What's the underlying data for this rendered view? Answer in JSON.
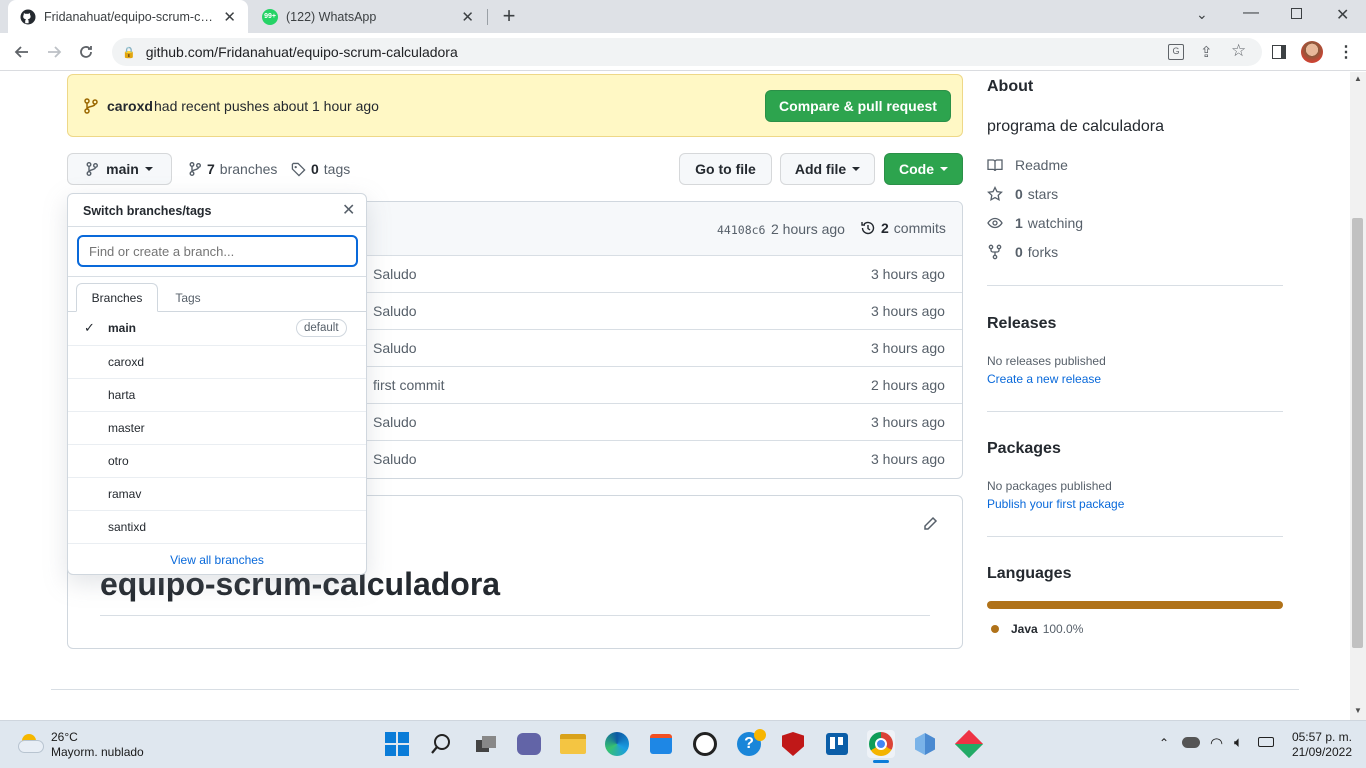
{
  "browser": {
    "tabs": [
      {
        "title": "Fridanahuat/equipo-scrum-calcuI",
        "icon": "github-icon"
      },
      {
        "title": "(122) WhatsApp",
        "icon": "whatsapp-icon",
        "badge": "99+"
      }
    ],
    "url": "github.com/Fridanahuat/equipo-scrum-calculadora"
  },
  "banner": {
    "user": "caroxd",
    "text": "had recent pushes about 1 hour ago",
    "button": "Compare & pull request"
  },
  "repo_nav": {
    "branch": "main",
    "branches_count": "7",
    "branches_label": "branches",
    "tags_count": "0",
    "tags_label": "tags",
    "go_to_file": "Go to file",
    "add_file": "Add file",
    "code": "Code"
  },
  "commit_bar": {
    "hash": "44108c6",
    "time": "2 hours ago",
    "commits_count": "2",
    "commits_label": "commits"
  },
  "files": [
    {
      "message": "Saludo",
      "time": "3 hours ago"
    },
    {
      "message": "Saludo",
      "time": "3 hours ago"
    },
    {
      "message": "Saludo",
      "time": "3 hours ago"
    },
    {
      "message": "first commit",
      "time": "2 hours ago"
    },
    {
      "message": "Saludo",
      "time": "3 hours ago"
    },
    {
      "message": "Saludo",
      "time": "3 hours ago"
    }
  ],
  "readme": {
    "heading": "equipo-scrum-calculadora"
  },
  "dropdown": {
    "title": "Switch branches/tags",
    "placeholder": "Find or create a branch...",
    "tab_branches": "Branches",
    "tab_tags": "Tags",
    "default_label": "default",
    "branches": [
      "main",
      "caroxd",
      "harta",
      "master",
      "otro",
      "ramav",
      "santixd"
    ],
    "view_all": "View all branches"
  },
  "sidebar": {
    "about_title": "About",
    "description": "programa de calculadora",
    "readme": "Readme",
    "stars_count": "0",
    "stars_label": "stars",
    "watching_count": "1",
    "watching_label": "watching",
    "forks_count": "0",
    "forks_label": "forks",
    "releases_title": "Releases",
    "releases_text": "No releases published",
    "releases_link": "Create a new release",
    "packages_title": "Packages",
    "packages_text": "No packages published",
    "packages_link": "Publish your first package",
    "languages_title": "Languages",
    "language_name": "Java",
    "language_percent": "100.0%",
    "language_share": 1.0,
    "language_color": "#b07219"
  },
  "taskbar": {
    "temp": "26°C",
    "weather": "Mayorm. nublado",
    "time": "05:57 p. m.",
    "date": "21/09/2022"
  },
  "colors": {
    "green": "#2da44e",
    "accent": "#0969da",
    "banner": "#fff8c5"
  }
}
